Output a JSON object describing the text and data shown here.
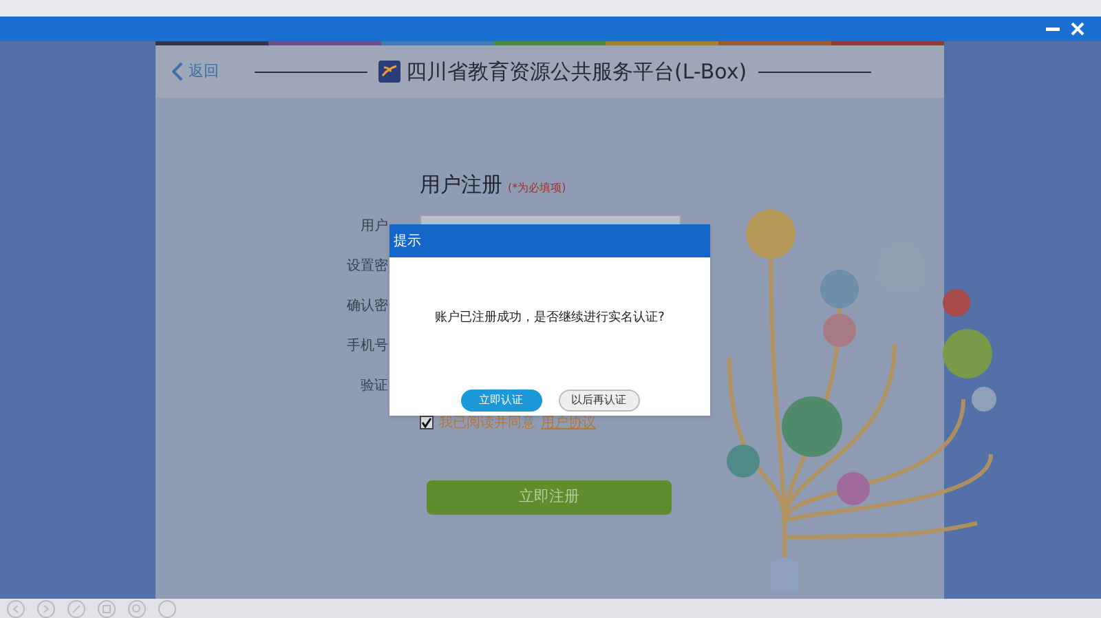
{
  "header": {
    "back_label": "返回",
    "title": "四川省教育资源公共服务平台(L-Box)"
  },
  "form": {
    "title": "用户注册",
    "required_note": "(*为必填项)",
    "fields": [
      {
        "label": "用户"
      },
      {
        "label": "设置密"
      },
      {
        "label": "确认密"
      },
      {
        "label": "手机号"
      },
      {
        "label": "验证"
      }
    ],
    "agreement": {
      "checked": true,
      "text": "我已阅读并同意",
      "link": "用户协议"
    },
    "submit": "立即注册"
  },
  "dialog": {
    "title": "提示",
    "message": "账户已注册成功，是否继续进行实名认证?",
    "buttons": [
      {
        "label": "立即认证",
        "kind": "primary"
      },
      {
        "label": "以后再认证",
        "kind": "secondary"
      }
    ]
  }
}
